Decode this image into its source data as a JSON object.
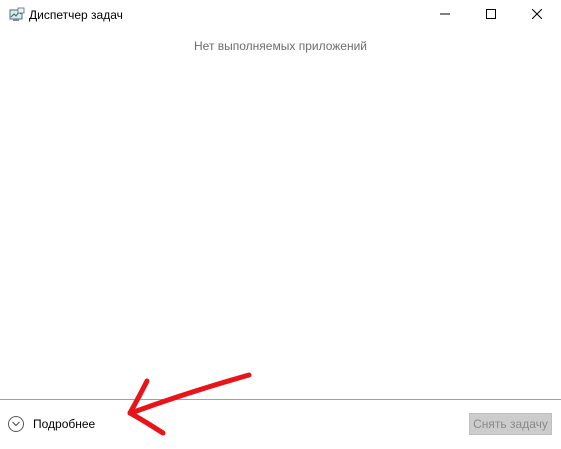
{
  "window": {
    "title": "Диспетчер задач",
    "icon": "task-manager-icon",
    "controls": [
      "minimize-icon",
      "maximize-icon",
      "close-icon"
    ]
  },
  "main": {
    "empty_message": "Нет выполняемых приложений"
  },
  "footer": {
    "more_details_label": "Подробнее",
    "more_details_icon": "chevron-down-icon",
    "end_task_label": "Снять задачу",
    "end_task_enabled": false
  },
  "annotation": {
    "icon": "red-arrow-icon",
    "color": "#e8141a"
  }
}
